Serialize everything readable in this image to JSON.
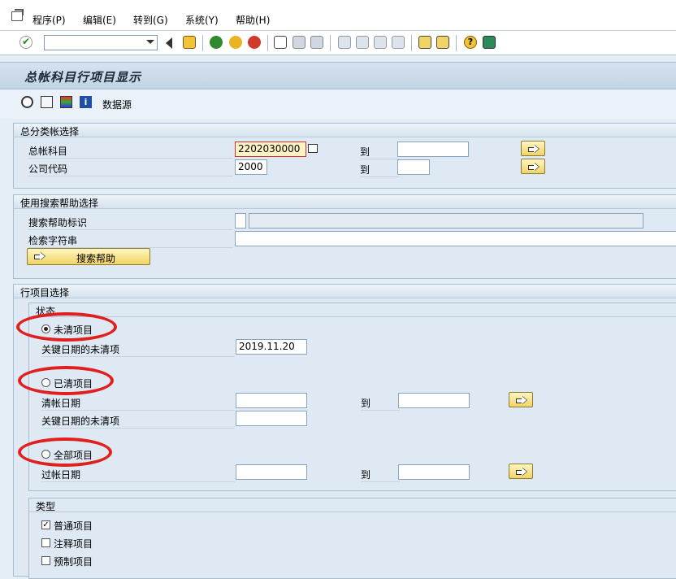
{
  "menu": [
    "程序(P)",
    "编辑(E)",
    "转到(G)",
    "系统(Y)",
    "帮助(H)"
  ],
  "page_title": "总帐科目行项目显示",
  "app_toolbar": {
    "datasource": "数据源"
  },
  "g1": {
    "title": "总分类帐选择",
    "account_label": "总帐科目",
    "account_value": "2202030000",
    "company_label": "公司代码",
    "company_value": "2000",
    "to1": "到",
    "to2": "到"
  },
  "g2": {
    "title": "使用搜索帮助选择",
    "id_label": "搜索帮助标识",
    "string_label": "检索字符串",
    "btn": "搜索帮助"
  },
  "g3": {
    "title": "行项目选择",
    "status_title": "状态",
    "open": "未清项目",
    "open_date_label": "关键日期的未清项",
    "open_date_value": "2019.11.20",
    "cleared": "已清项目",
    "clear_date_label": "清帐日期",
    "cleared_key_label": "关键日期的未清项",
    "to_c": "到",
    "all": "全部项目",
    "post_date_label": "过帐日期",
    "to_a": "到",
    "type_title": "类型",
    "t1": "普通项目",
    "t2": "注释项目",
    "t3": "预制项目"
  },
  "colors": {
    "highlight": "#e0201e",
    "button": "#f1d466"
  }
}
